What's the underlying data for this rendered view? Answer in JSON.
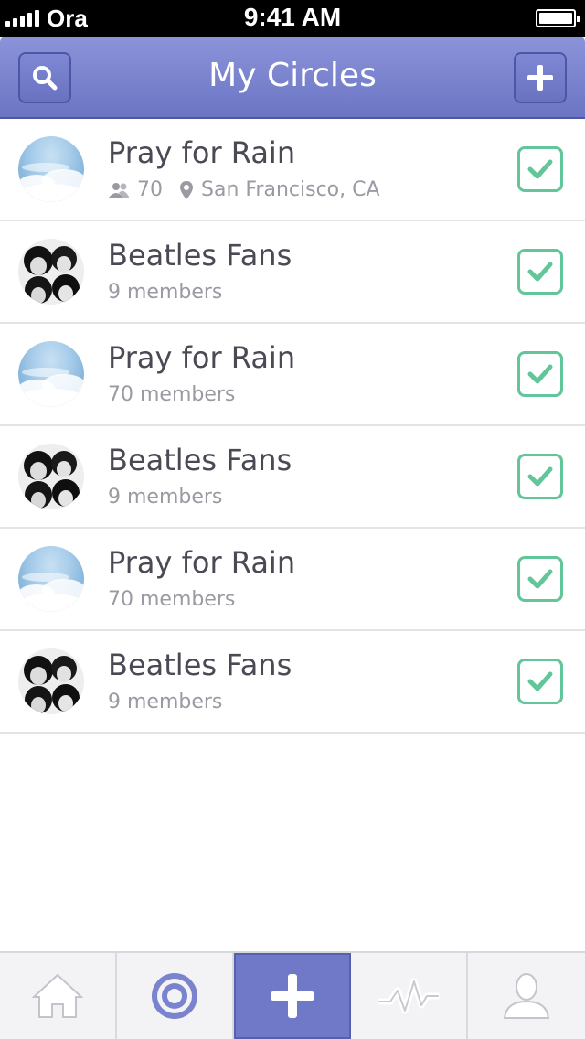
{
  "status_bar": {
    "carrier": "Ora",
    "time": "9:41 AM"
  },
  "nav": {
    "title": "My Circles",
    "search_icon": "search-icon",
    "add_icon": "plus-icon"
  },
  "colors": {
    "nav": "#7a83cd",
    "check": "#63c59a",
    "text": "#4a4a55",
    "muted": "#9a9aa3",
    "tab_active": "#6f79c8"
  },
  "circles": [
    {
      "name": "Pray for Rain",
      "member_count": "70",
      "location": "San Francisco, CA",
      "image": "clouds",
      "checked": true
    },
    {
      "name": "Beatles Fans",
      "meta": "9 members",
      "image": "beatles",
      "checked": true
    },
    {
      "name": "Pray for Rain",
      "meta": "70 members",
      "image": "clouds",
      "checked": true
    },
    {
      "name": "Beatles Fans",
      "meta": "9 members",
      "image": "beatles",
      "checked": true
    },
    {
      "name": "Pray for Rain",
      "meta": "70 members",
      "image": "clouds",
      "checked": true
    },
    {
      "name": "Beatles Fans",
      "meta": "9 members",
      "image": "beatles",
      "checked": true
    }
  ],
  "tabs": [
    {
      "icon": "home-icon",
      "active": false
    },
    {
      "icon": "target-icon",
      "active": false
    },
    {
      "icon": "plus-icon",
      "active": true
    },
    {
      "icon": "activity-icon",
      "active": false
    },
    {
      "icon": "profile-icon",
      "active": false
    }
  ]
}
